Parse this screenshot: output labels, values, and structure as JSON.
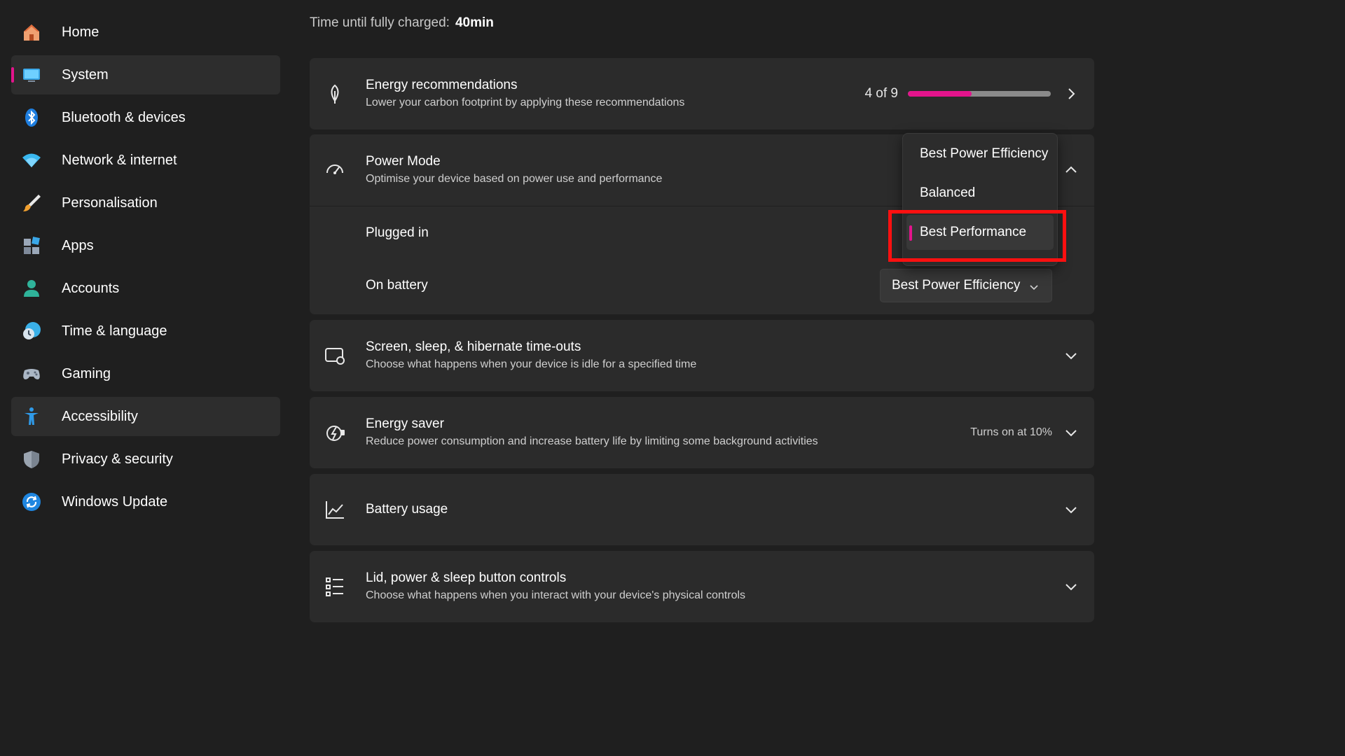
{
  "sidebar": {
    "items": [
      {
        "label": "Home",
        "icon": "home-icon"
      },
      {
        "label": "System",
        "icon": "monitor-icon",
        "selected": true
      },
      {
        "label": "Bluetooth & devices",
        "icon": "bluetooth-icon"
      },
      {
        "label": "Network & internet",
        "icon": "wifi-icon"
      },
      {
        "label": "Personalisation",
        "icon": "brush-icon"
      },
      {
        "label": "Apps",
        "icon": "apps-icon"
      },
      {
        "label": "Accounts",
        "icon": "person-icon"
      },
      {
        "label": "Time & language",
        "icon": "clock-globe-icon"
      },
      {
        "label": "Gaming",
        "icon": "gamepad-icon"
      },
      {
        "label": "Accessibility",
        "icon": "accessibility-icon",
        "hovered": true
      },
      {
        "label": "Privacy & security",
        "icon": "shield-icon"
      },
      {
        "label": "Windows Update",
        "icon": "update-icon"
      }
    ]
  },
  "charge": {
    "label": "Time until fully charged:",
    "value": "40min"
  },
  "energy_recommendations": {
    "title": "Energy recommendations",
    "desc": "Lower your carbon footprint by applying these recommendations",
    "count": "4 of 9",
    "progress_fraction": 0.444
  },
  "power_mode": {
    "title": "Power Mode",
    "desc": "Optimise your device based on power use and performance",
    "plugged_in_label": "Plugged in",
    "on_battery_label": "On battery",
    "on_battery_value": "Best Power Efficiency"
  },
  "dropdown": {
    "options": [
      "Best Power Efficiency",
      "Balanced",
      "Best Performance"
    ],
    "selected": "Best Performance"
  },
  "screen_sleep": {
    "title": "Screen, sleep, & hibernate time-outs",
    "desc": "Choose what happens when your device is idle for a specified time"
  },
  "energy_saver": {
    "title": "Energy saver",
    "desc": "Reduce power consumption and increase battery life by limiting some background activities",
    "status": "Turns on at 10%"
  },
  "battery_usage": {
    "title": "Battery usage"
  },
  "lid_controls": {
    "title": "Lid, power & sleep button controls",
    "desc": "Choose what happens when you interact with your device's physical controls"
  },
  "colors": {
    "accent": "#e3148c",
    "highlight": "#ff1010",
    "background": "#1f1f1f",
    "card": "#2b2b2b"
  }
}
